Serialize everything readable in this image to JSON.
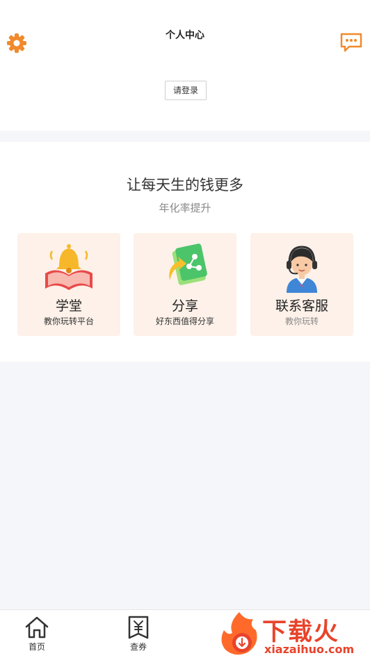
{
  "header": {
    "title": "个人中心",
    "login_button": "请登录",
    "settings_icon": "gear-icon",
    "message_icon": "chat-bubble-icon",
    "accent_color": "#f08a2c"
  },
  "promo": {
    "headline": "让每天生的钱更多",
    "subline": "年化率提升"
  },
  "features": [
    {
      "title": "学堂",
      "subtitle": "教你玩转平台",
      "icon": "book-bell-icon"
    },
    {
      "title": "分享",
      "subtitle": "好东西值得分享",
      "icon": "share-icon"
    },
    {
      "title": "联系客服",
      "subtitle": "教你玩转",
      "icon": "customer-service-icon"
    }
  ],
  "tabbar": {
    "items": [
      {
        "label": "首页",
        "icon": "home-icon"
      },
      {
        "label": "查券",
        "icon": "coupon-icon"
      }
    ]
  },
  "watermark": {
    "text": "下载火",
    "url": "xiazaihuo.com"
  }
}
